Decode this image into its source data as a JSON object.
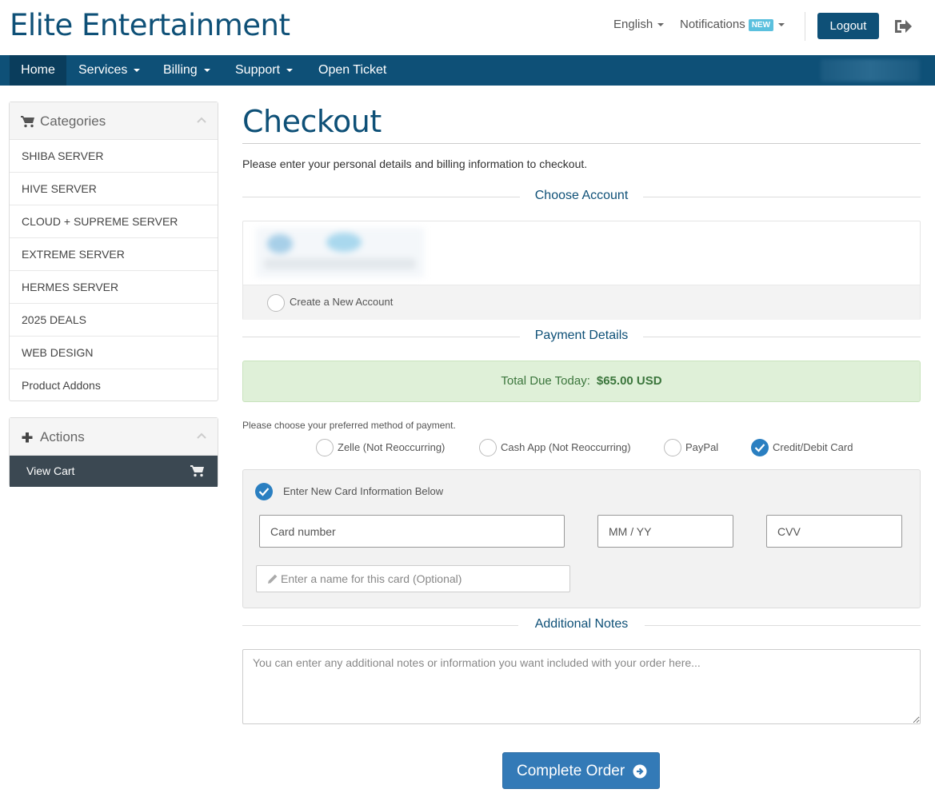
{
  "header": {
    "brand": "Elite Entertainment",
    "language": "English",
    "notifications": "Notifications",
    "notifications_badge": "NEW",
    "logout": "Logout"
  },
  "nav": {
    "items": [
      {
        "label": "Home",
        "dropdown": false
      },
      {
        "label": "Services",
        "dropdown": true
      },
      {
        "label": "Billing",
        "dropdown": true
      },
      {
        "label": "Support",
        "dropdown": true
      },
      {
        "label": "Open Ticket",
        "dropdown": false
      }
    ]
  },
  "sidebar": {
    "categories_title": "Categories",
    "categories": [
      "SHIBA SERVER",
      "HIVE SERVER",
      "CLOUD + SUPREME SERVER",
      "EXTREME SERVER",
      "HERMES SERVER",
      "2025 DEALS",
      "WEB DESIGN",
      "Product Addons"
    ],
    "actions_title": "Actions",
    "view_cart": "View Cart"
  },
  "main": {
    "title": "Checkout",
    "intro": "Please enter your personal details and billing information to checkout.",
    "choose_account_heading": "Choose Account",
    "create_account_label": "Create a New Account",
    "payment_heading": "Payment Details",
    "total_label": "Total Due Today:",
    "total_value": "$65.00 USD",
    "choose_method": "Please choose your preferred method of payment.",
    "payment_methods": [
      {
        "label": "Zelle (Not Reoccurring)",
        "selected": false
      },
      {
        "label": "Cash App (Not Reoccurring)",
        "selected": false
      },
      {
        "label": "PayPal",
        "selected": false
      },
      {
        "label": "Credit/Debit Card",
        "selected": true
      }
    ],
    "new_card_label": "Enter New Card Information Below",
    "card_number_placeholder": "Card number",
    "expiry_placeholder": "MM / YY",
    "cvv_placeholder": "CVV",
    "card_name_placeholder": "Enter a name for this card (Optional)",
    "notes_heading": "Additional Notes",
    "notes_placeholder": "You can enter any additional notes or information you want included with your order here...",
    "complete_order": "Complete Order"
  },
  "colors": {
    "brand": "#0e5077",
    "primary_button": "#337ab7",
    "success_bg": "#dff0d8",
    "checked_radio": "#2a7fc1"
  }
}
